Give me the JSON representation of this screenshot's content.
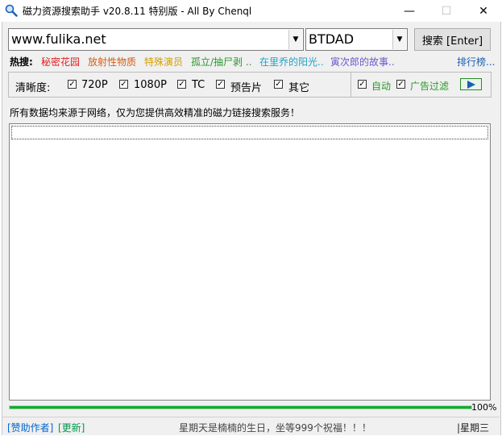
{
  "window": {
    "title": "磁力资源搜索助手 v20.8.11 特别版 - All By Chenql"
  },
  "search": {
    "url_value": "www.fulika.net",
    "engine_value": "BTDAD",
    "button_label": "搜索 [Enter]"
  },
  "hot": {
    "label": "热搜:",
    "items": [
      {
        "text": "秘密花园",
        "color": "#d22"
      },
      {
        "text": "放射性物质",
        "color": "#d85c10"
      },
      {
        "text": "特殊演员",
        "color": "#d4a000"
      },
      {
        "text": "孤立/抽尸剥 ..",
        "color": "#2a9a2a"
      },
      {
        "text": "在里乔的阳光..",
        "color": "#1ea3c8"
      },
      {
        "text": "寅次郎的故事..",
        "color": "#6a5acd"
      }
    ],
    "ranking_link": "排行榜..."
  },
  "filters": {
    "label": "清晰度:",
    "options": [
      {
        "label": "720P",
        "checked": true
      },
      {
        "label": "1080P",
        "checked": true
      },
      {
        "label": "TC",
        "checked": true
      },
      {
        "label": "预告片",
        "checked": true
      },
      {
        "label": "其它",
        "checked": true
      }
    ],
    "auto_label": "自动",
    "ad_filter_label": "广告过滤"
  },
  "notice": "所有数据均来源于网络，仅为您提供高效精准的磁力链接搜索服务！",
  "progress": {
    "percent": 100,
    "text": "100%"
  },
  "status": {
    "donate": "[赞助作者]",
    "update": "[更新]",
    "message": "星期天是楠楠的生日，坐等999个祝福！！！",
    "day": "|星期三"
  }
}
